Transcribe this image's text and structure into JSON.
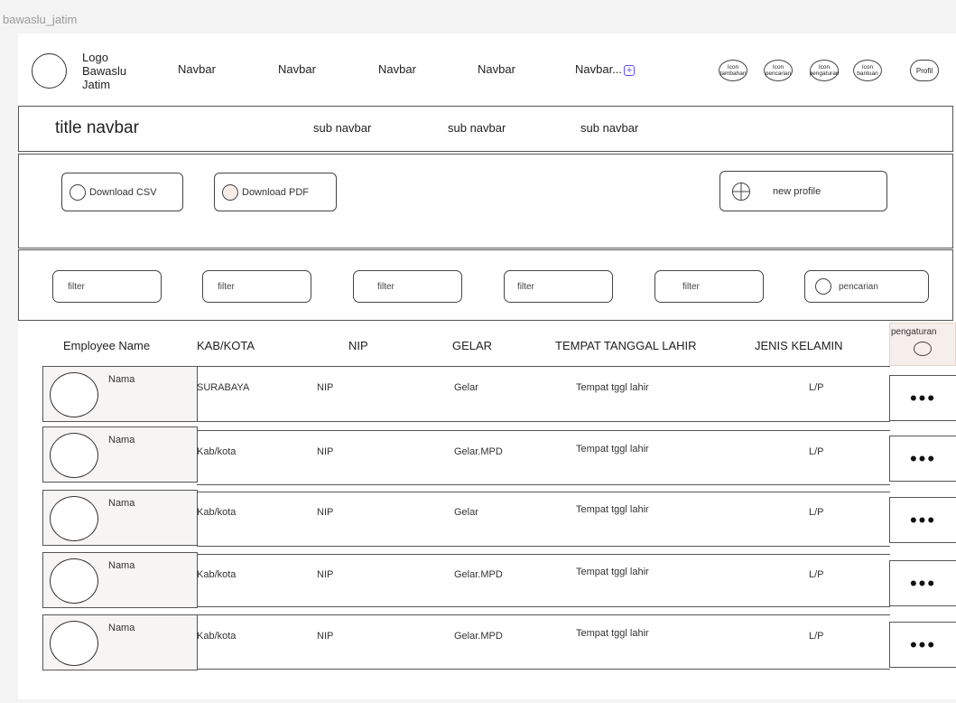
{
  "frame_label": "bawaslu_jatim",
  "logo": {
    "line1": "Logo",
    "line2": "Bawaslu",
    "line3": "Jatim"
  },
  "navbar": {
    "items": [
      "Navbar",
      "Navbar",
      "Navbar",
      "Navbar",
      "Navbar..."
    ]
  },
  "header_icons": [
    {
      "line1": "Icon",
      "line2": "tambahan"
    },
    {
      "line1": "Icon",
      "line2": "pencarian"
    },
    {
      "line1": "Icon",
      "line2": "pengaturan"
    },
    {
      "line1": "Icon",
      "line2": "bantuan"
    }
  ],
  "profil": "Profil",
  "title_navbar": "title navbar",
  "sub_navbar": [
    "sub navbar",
    "sub navbar",
    "sub navbar"
  ],
  "actions": {
    "download_csv": "Download CSV",
    "download_pdf": "Download PDF",
    "new_profile": "new profile"
  },
  "filters": [
    "filter",
    "filter",
    "filter",
    "filter",
    "filter"
  ],
  "search_label": "pencarian",
  "table": {
    "headers": [
      "Employee Name",
      "KAB/KOTA",
      "NIP",
      "GELAR",
      "TEMPAT TANGGAL LAHIR",
      "JENIS KELAMIN"
    ],
    "settings_header": "pengaturan",
    "rows": [
      {
        "name": "Nama",
        "kab": "SURABAYA",
        "nip": "NIP",
        "gelar": "Gelar",
        "ttl": "Tempat tggl lahir",
        "jk": "L/P",
        "actions": "•••"
      },
      {
        "name": "Nama",
        "kab": "Kab/kota",
        "nip": "NIP",
        "gelar": "Gelar.MPD",
        "ttl": "Tempat tggl lahir",
        "jk": "L/P",
        "actions": "•••"
      },
      {
        "name": "Nama",
        "kab": "Kab/kota",
        "nip": "NIP",
        "gelar": "Gelar",
        "ttl": "Tempat tggl lahir",
        "jk": "L/P",
        "actions": "•••"
      },
      {
        "name": "Nama",
        "kab": "Kab/kota",
        "nip": "NIP",
        "gelar": "Gelar.MPD",
        "ttl": "Tempat tggl lahir",
        "jk": "L/P",
        "actions": "•••"
      },
      {
        "name": "Nama",
        "kab": "Kab/kota",
        "nip": "NIP",
        "gelar": "Gelar.MPD",
        "ttl": "Tempat tggl lahir",
        "jk": "L/P",
        "actions": "•••"
      }
    ]
  }
}
